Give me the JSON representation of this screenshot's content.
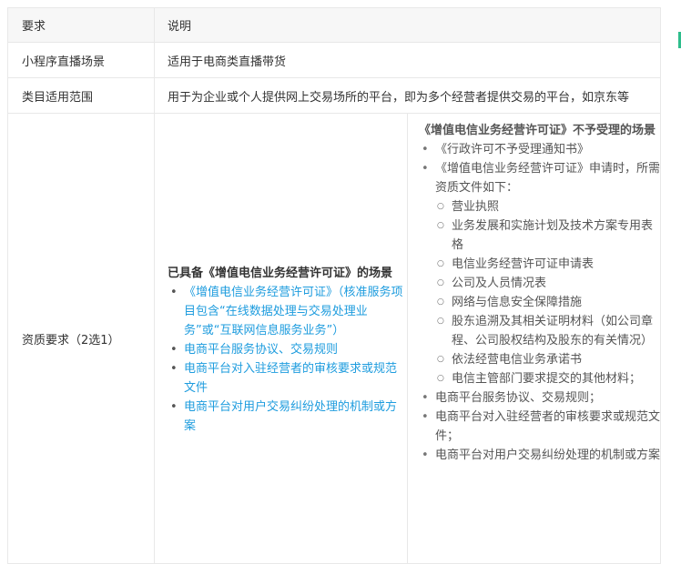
{
  "table": {
    "header": {
      "col1": "要求",
      "col2": "说明"
    },
    "row_scene": {
      "label": "小程序直播场景",
      "value": "适用于电商类直播带货"
    },
    "row_category": {
      "label": "类目适用范围",
      "value": "用于为企业或个人提供网上交易场所的平台，即为多个经营者提供交易的平台，如京东等"
    },
    "row_qualification": {
      "label": "资质要求（2选1）",
      "left": {
        "title": "已具备《增值电信业务经营许可证》的场景",
        "items": [
          "《增值电信业务经营许可证》（核准服务项目包含“在线数据处理与交易处理业务”或“互联网信息服务业务”）",
          "电商平台服务协议、交易规则",
          "电商平台对入驻经营者的审核要求或规范文件",
          "电商平台对用户交易纠纷处理的机制或方案"
        ]
      },
      "right": {
        "title": "《增值电信业务经营许可证》不予受理的场景",
        "item_notice": "《行政许可不予受理通知书》",
        "item_apply": "《增值电信业务经营许可证》申请时，所需资质文件如下：",
        "sub_items": [
          "营业执照",
          "业务发展和实施计划及技术方案专用表格",
          "电信业务经营许可证申请表",
          "公司及人员情况表",
          "网络与信息安全保障措施",
          "股东追溯及其相关证明材料（如公司章程、公司股权结构及股东的有关情况）",
          "依法经营电信业务承诺书",
          "电信主管部门要求提交的其他材料；"
        ],
        "items_after": [
          "电商平台服务协议、交易规则；",
          "电商平台对入驻经营者的审核要求或规范文件；",
          "电商平台对用户交易纠纷处理的机制或方案"
        ]
      }
    }
  },
  "colors": {
    "link_blue": "#1e9cde",
    "header_bg": "#f7f7f7",
    "border": "#e8e8e8",
    "accent_green": "#2ebd8c"
  }
}
